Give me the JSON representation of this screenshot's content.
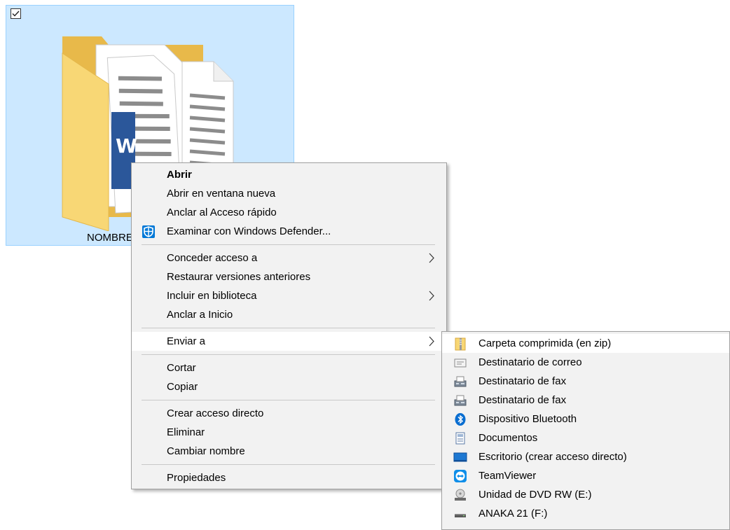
{
  "folder": {
    "label": "NOMBRE"
  },
  "context_menu": {
    "items": [
      {
        "label": "Abrir"
      },
      {
        "label": "Abrir en ventana nueva"
      },
      {
        "label": "Anclar al Acceso rápido"
      },
      {
        "label": "Examinar con Windows Defender...",
        "icon": "windows-defender-icon"
      },
      {
        "label": "Conceder acceso a",
        "submenu": true
      },
      {
        "label": "Restaurar versiones anteriores"
      },
      {
        "label": "Incluir en biblioteca",
        "submenu": true
      },
      {
        "label": "Anclar a Inicio"
      },
      {
        "label": "Enviar a",
        "submenu": true,
        "highlighted": true
      },
      {
        "label": "Cortar"
      },
      {
        "label": "Copiar"
      },
      {
        "label": "Crear acceso directo"
      },
      {
        "label": "Eliminar"
      },
      {
        "label": "Cambiar nombre"
      },
      {
        "label": "Propiedades"
      }
    ]
  },
  "send_to_menu": {
    "items": [
      {
        "label": "Carpeta comprimida (en zip)",
        "icon": "zip-folder-icon"
      },
      {
        "label": "Destinatario de correo",
        "icon": "mail-recipient-icon"
      },
      {
        "label": "Destinatario de fax",
        "icon": "fax-icon"
      },
      {
        "label": "Destinatario de fax",
        "icon": "fax-icon"
      },
      {
        "label": "Dispositivo Bluetooth",
        "icon": "bluetooth-icon"
      },
      {
        "label": "Documentos",
        "icon": "documents-icon"
      },
      {
        "label": "Escritorio (crear acceso directo)",
        "icon": "desktop-icon"
      },
      {
        "label": "TeamViewer",
        "icon": "teamviewer-icon"
      },
      {
        "label": "Unidad de DVD RW (E:)",
        "icon": "dvd-drive-icon"
      },
      {
        "label": "ANAKA 21 (F:)",
        "icon": "usb-drive-icon"
      }
    ]
  },
  "colors": {
    "selection_fill": "#cce8ff",
    "selection_border": "#99d1ff",
    "menu_background": "#f2f2f2",
    "folder_yellow": "#f8d775",
    "word_blue": "#2b579a"
  }
}
